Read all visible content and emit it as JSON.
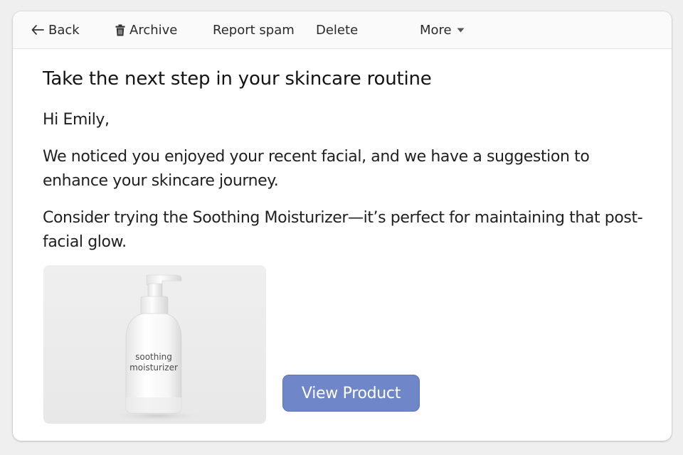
{
  "toolbar": {
    "back_label": "Back",
    "archive_label": "Archive",
    "spam_label": "Report spam",
    "delete_label": "Delete",
    "more_label": "More",
    "icons": {
      "back": "arrow-left-icon",
      "archive": "trash-icon",
      "more": "caret-down-icon"
    }
  },
  "email": {
    "subject": "Take the next step in your skincare routine",
    "greeting": "Hi Emily,",
    "paragraphs": [
      "We noticed you enjoyed your recent facial, and we have a suggestion to enhance your skincare journey.",
      "Consider trying the Soothing Moisturizer—it’s perfect for maintaining that post-facial glow."
    ],
    "product": {
      "label_line1": "soothing",
      "label_line2": "moisturizer"
    },
    "cta_label": "View Product"
  },
  "colors": {
    "cta_background": "#6f86c9",
    "window_background": "#ffffff",
    "page_background": "#efefef"
  }
}
